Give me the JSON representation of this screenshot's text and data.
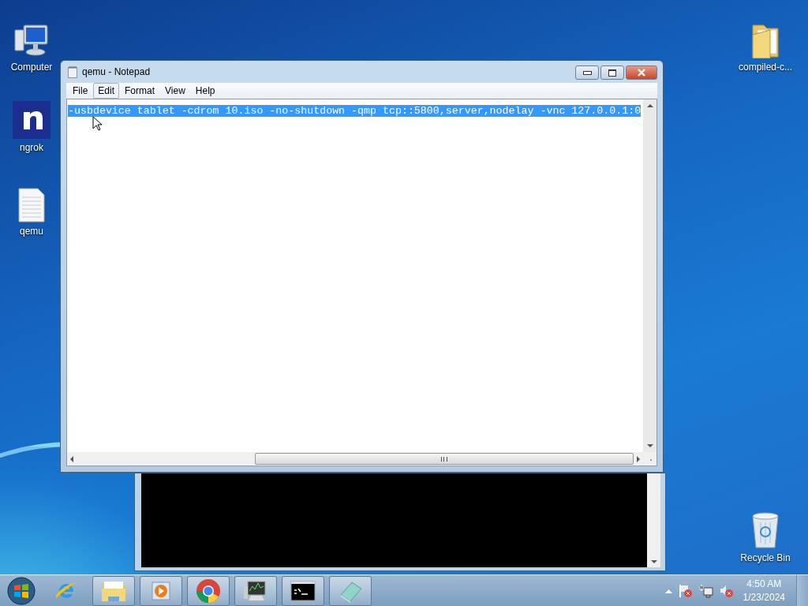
{
  "desktop_icons": [
    {
      "label": "Computer",
      "kind": "computer"
    },
    {
      "label": "ngrok",
      "kind": "app"
    },
    {
      "label": "qemu",
      "kind": "textfile"
    },
    {
      "label": "compiled-c...",
      "kind": "folder"
    },
    {
      "label": "Recycle Bin",
      "kind": "recycle"
    }
  ],
  "notepad": {
    "title": "qemu - Notepad",
    "menu": [
      {
        "label": "File",
        "selected": false
      },
      {
        "label": "Edit",
        "selected": true
      },
      {
        "label": "Format",
        "selected": false
      },
      {
        "label": "View",
        "selected": false
      },
      {
        "label": "Help",
        "selected": false
      }
    ],
    "text": "-usbdevice tablet -cdrom 10.iso -no-shutdown -qmp tcp::5800,server,nodelay -vnc 127.0.0.1:0",
    "text_selected": true
  },
  "taskbar": {
    "items": [
      {
        "kind": "ie",
        "running": false
      },
      {
        "kind": "explorer",
        "running": true
      },
      {
        "kind": "media",
        "running": true
      },
      {
        "kind": "chrome",
        "running": true
      },
      {
        "kind": "monitor",
        "running": true
      },
      {
        "kind": "cmd",
        "running": true
      },
      {
        "kind": "notepad",
        "running": true
      }
    ],
    "time": "4:50 AM",
    "date": "1/23/2024"
  }
}
